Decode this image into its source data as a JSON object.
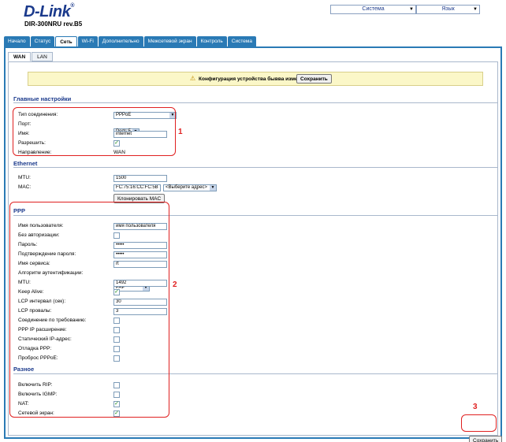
{
  "brand": {
    "logo": "D-Link",
    "model": "DIR-300NRU rev.B5"
  },
  "top_selects": {
    "system": "Система",
    "language": "Язык"
  },
  "main_nav": [
    "Начало",
    "Статус",
    "Сеть",
    "Wi-Fi",
    "Дополнительно",
    "Межсетевой экран",
    "Контроль",
    "Система"
  ],
  "sub_nav": [
    "WAN",
    "LAN"
  ],
  "notice": {
    "text": "Конфигурация устройства бывва изменена",
    "button": "Сохранить"
  },
  "main_settings": {
    "title": "Главные настройки",
    "conn_type_label": "Тип соединения:",
    "conn_type_value": "PPPoE",
    "port_label": "Порт:",
    "port_value": "Ports:5",
    "name_label": "Имя:",
    "name_value": "internet",
    "enable_label": "Разрешить:",
    "direction_label": "Направление:",
    "direction_value": "WAN"
  },
  "ethernet": {
    "title": "Ethernet",
    "mtu_label": "MTU:",
    "mtu_value": "1500",
    "mac_label": "MAC:",
    "mac_value": "FC:75:16:CC:FC:5B",
    "mac_select": "<Выберите адрес>",
    "clone_button": "Клонировать MAC"
  },
  "ppp": {
    "title": "PPP",
    "user_label": "Имя пользователя:",
    "user_value": "имя пользователя",
    "noauth_label": "Без авторизации:",
    "pass_label": "Пароль:",
    "pass_value": "•••••",
    "pass2_label": "Подтверждение пароля:",
    "pass2_value": "•••••",
    "service_label": "Имя сервиса:",
    "service_value": "rt",
    "auth_label": "Алгоритм аутентификации:",
    "auth_value": "PAP",
    "mtu_label": "MTU:",
    "mtu_value": "1492",
    "keepalive_label": "Keep Alive:",
    "lcp_int_label": "LCP интервал (сек):",
    "lcp_int_value": "30",
    "lcp_fail_label": "LCP провалы:",
    "lcp_fail_value": "3",
    "ondemand_label": "Соединение по требованию:",
    "ipext_label": "PPP IP расширение:",
    "staticip_label": "Статический IP-адрес:",
    "debug_label": "Отладка PPP:",
    "passthru_label": "Проброс PPPoE:"
  },
  "misc": {
    "title": "Разное",
    "rip_label": "Включить RIP:",
    "igmp_label": "Включить IGMP:",
    "nat_label": "NAT:",
    "firewall_label": "Сетевой экран:"
  },
  "save_button": "Сохранить",
  "callouts": [
    "1",
    "2",
    "3"
  ],
  "colors": {
    "accent": "#2a7ab5",
    "highlight": "#e02020",
    "check": "#1a8a1a"
  }
}
